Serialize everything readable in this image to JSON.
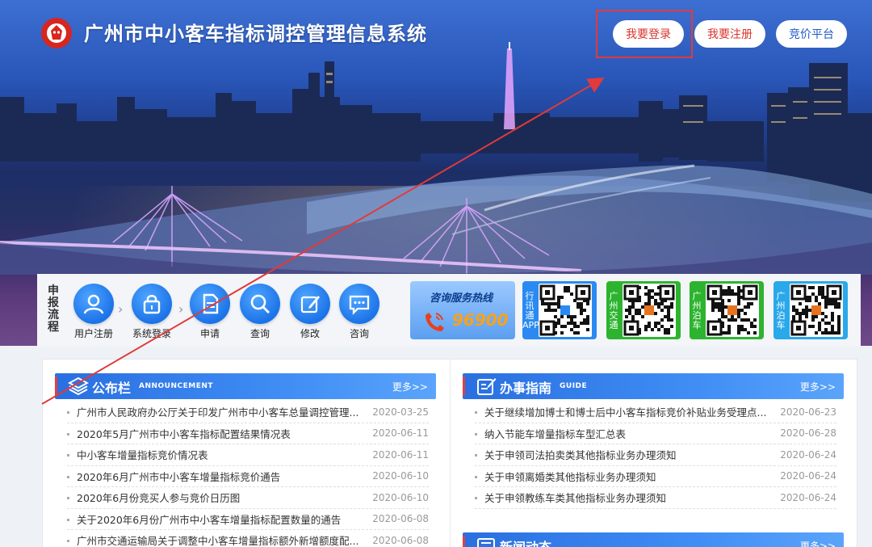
{
  "header": {
    "site_title": "广州市中小客车指标调控管理信息系统",
    "buttons": {
      "login": "我要登录",
      "register": "我要注册",
      "bid_platform": "竞价平台"
    }
  },
  "process": {
    "label": "申报流程",
    "steps": [
      {
        "label": "用户注册",
        "icon": "user-icon"
      },
      {
        "label": "系统登录",
        "icon": "lock-icon"
      },
      {
        "label": "申请",
        "icon": "document-icon"
      },
      {
        "label": "查询",
        "icon": "search-icon"
      },
      {
        "label": "修改",
        "icon": "edit-icon"
      },
      {
        "label": "咨询",
        "icon": "chat-icon"
      }
    ],
    "hotline": {
      "title": "咨询服务热线",
      "number": "96900"
    },
    "qr_cards": [
      {
        "label": "行讯通APP",
        "color": "#2a8af2"
      },
      {
        "label": "广州交通",
        "color": "#2db42f"
      },
      {
        "label": "广州泊车",
        "color": "#2db42f"
      },
      {
        "label": "广州泊车",
        "color": "#29a8ea"
      }
    ]
  },
  "announcement": {
    "title_cn": "公布栏",
    "title_en": "ANNOUNCEMENT",
    "more": "更多>>",
    "items": [
      {
        "text": "广州市人民政府办公厅关于印发广州市中小客车总量调控管理...",
        "date": "2020-03-25"
      },
      {
        "text": "2020年5月广州市中小客车指标配置结果情况表",
        "date": "2020-06-11"
      },
      {
        "text": "中小客车增量指标竞价情况表",
        "date": "2020-06-11"
      },
      {
        "text": "2020年6月广州市中小客车增量指标竞价通告",
        "date": "2020-06-10"
      },
      {
        "text": "2020年6月份竞买人参与竞价日历图",
        "date": "2020-06-10"
      },
      {
        "text": "关于2020年6月份广州市中小客车增量指标配置数量的通告",
        "date": "2020-06-08"
      },
      {
        "text": "广州市交通运输局关于调整中小客车增量指标额外新增额度配...",
        "date": "2020-06-08"
      }
    ]
  },
  "guide": {
    "title_cn": "办事指南",
    "title_en": "GUIDE",
    "more": "更多>>",
    "items": [
      {
        "text": "关于继续增加博士和博士后中小客车指标竞价补贴业务受理点...",
        "date": "2020-06-23"
      },
      {
        "text": "纳入节能车增量指标车型汇总表",
        "date": "2020-06-28"
      },
      {
        "text": "关于申领司法拍卖类其他指标业务办理须知",
        "date": "2020-06-24"
      },
      {
        "text": "关于申领离婚类其他指标业务办理须知",
        "date": "2020-06-24"
      },
      {
        "text": "关于申领教练车类其他指标业务办理须知",
        "date": "2020-06-24"
      }
    ]
  },
  "news": {
    "title_cn": "新闻动态",
    "more": "更多>>"
  },
  "colors": {
    "accent_red": "#d9342b",
    "panel_blue": "#2a6fe0",
    "annotation_red": "#e23a3a"
  }
}
